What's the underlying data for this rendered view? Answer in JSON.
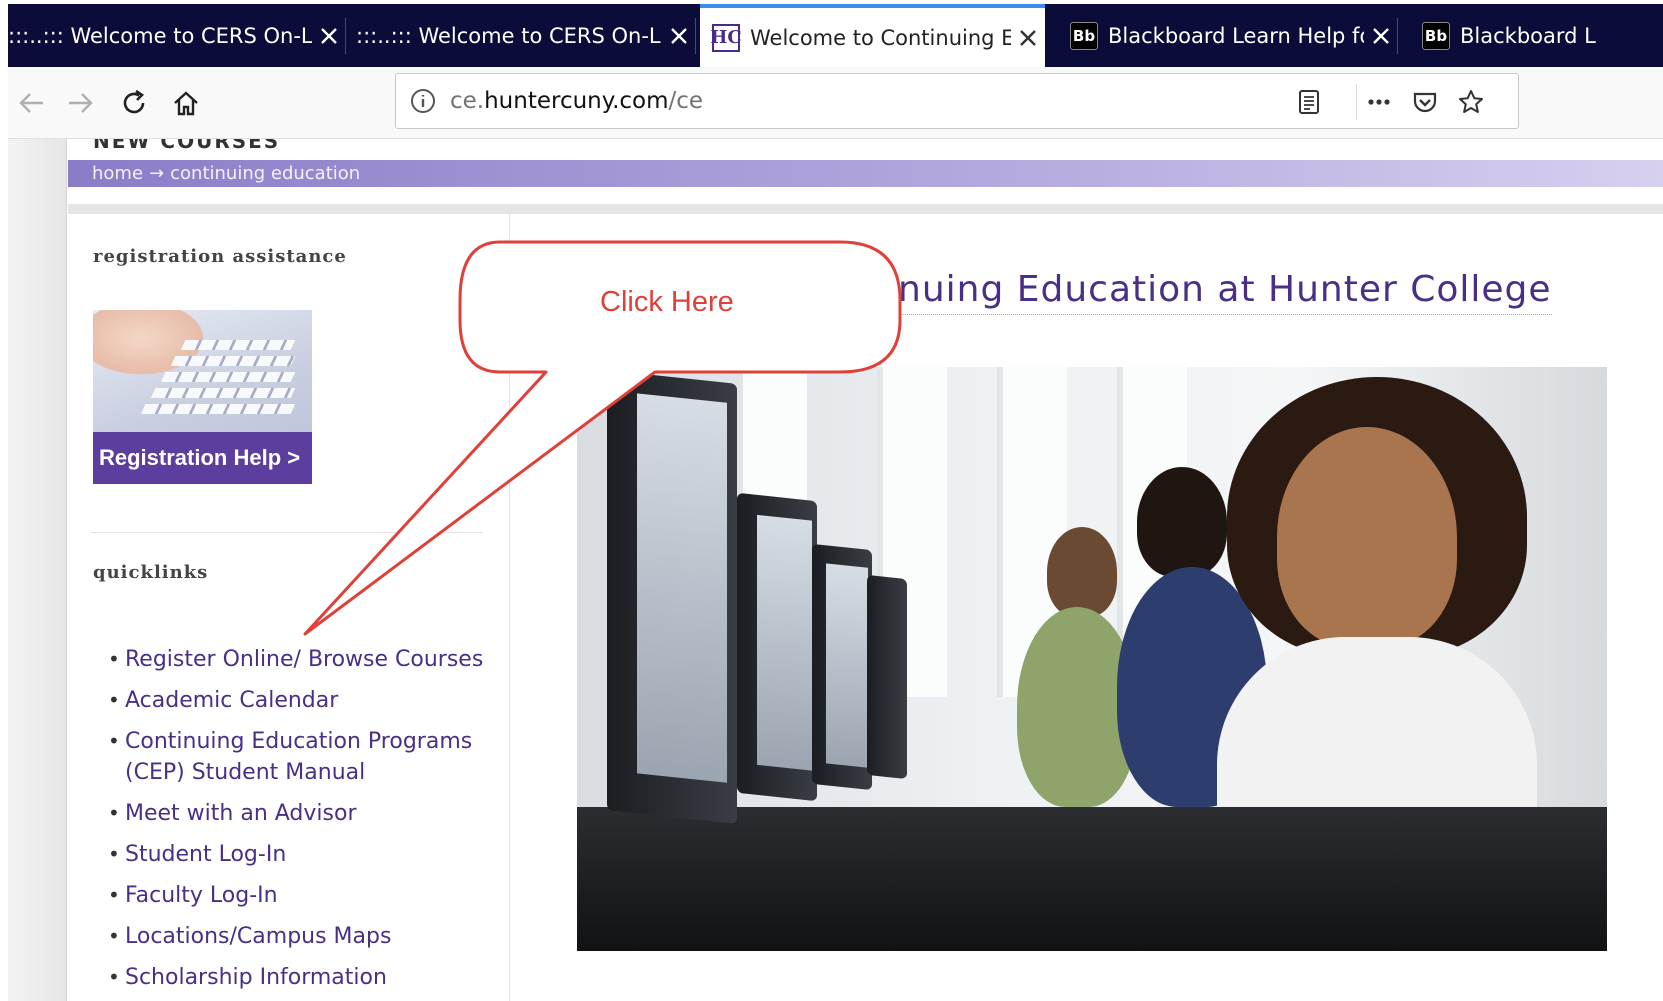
{
  "tabs": [
    {
      "title": ":::..::: Welcome to CERS On-Line! ::",
      "favicon": "none",
      "active": false
    },
    {
      "title": ":::..::: Welcome to CERS On-Line! ::",
      "favicon": "none",
      "active": false
    },
    {
      "title": "Welcome to Continuing Educa",
      "favicon": "HC",
      "active": true
    },
    {
      "title": "Blackboard Learn Help for Stu",
      "favicon": "Bb",
      "active": false
    },
    {
      "title": "Blackboard L",
      "favicon": "Bb",
      "active": false
    }
  ],
  "navbar": {
    "url_prefix": "ce.",
    "url_domain": "huntercuny.com",
    "url_path": "/ce"
  },
  "page": {
    "banner_text": "NEW COURSES",
    "breadcrumb_home": "home",
    "breadcrumb_arrow": "→",
    "breadcrumb_current": "continuing education",
    "registration_heading": "registration assistance",
    "registration_button": "Registration Help >",
    "quicklinks_heading": "quicklinks",
    "quicklinks": [
      "Register Online/ Browse Courses",
      "Academic Calendar",
      "Continuing Education Programs (CEP) Student Manual",
      "Meet with an Advisor",
      "Student Log-In",
      "Faculty Log-In",
      "Locations/Campus Maps",
      "Scholarship Information"
    ],
    "title_visible": "nuing Education at Hunter College"
  },
  "callout": {
    "text": "Click Here",
    "color": "#e0403a"
  },
  "colors": {
    "tabstrip": "#0c0c3a",
    "accent_purple": "#4a2f86",
    "breadcrumb_bar": "#8c7cc8",
    "reg_button": "#5b3e9e"
  }
}
